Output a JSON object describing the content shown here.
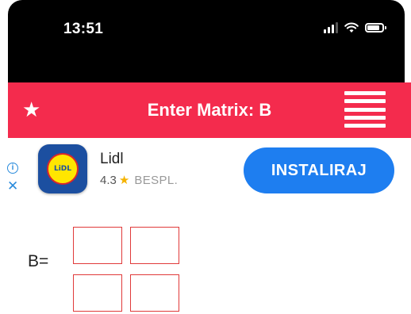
{
  "status_bar": {
    "time": "13:51",
    "icons": [
      "signal-icon",
      "wifi-icon",
      "battery-icon"
    ]
  },
  "app_bar": {
    "title": "Enter Matrix: B",
    "background_color": "#f42b4d",
    "icons": [
      "star-icon",
      "menu-icon"
    ]
  },
  "ad": {
    "name": "Lidl",
    "rating": "4.3",
    "price": "BESPL.",
    "button_label": "INSTALIRAJ",
    "button_color": "#1e7ef0",
    "icons": [
      "info-icon",
      "close-icon",
      "lidl-logo"
    ]
  },
  "matrix": {
    "label": "B=",
    "rows": 2,
    "cols": 2,
    "cells": [
      [
        "",
        ""
      ],
      [
        "",
        ""
      ]
    ]
  }
}
